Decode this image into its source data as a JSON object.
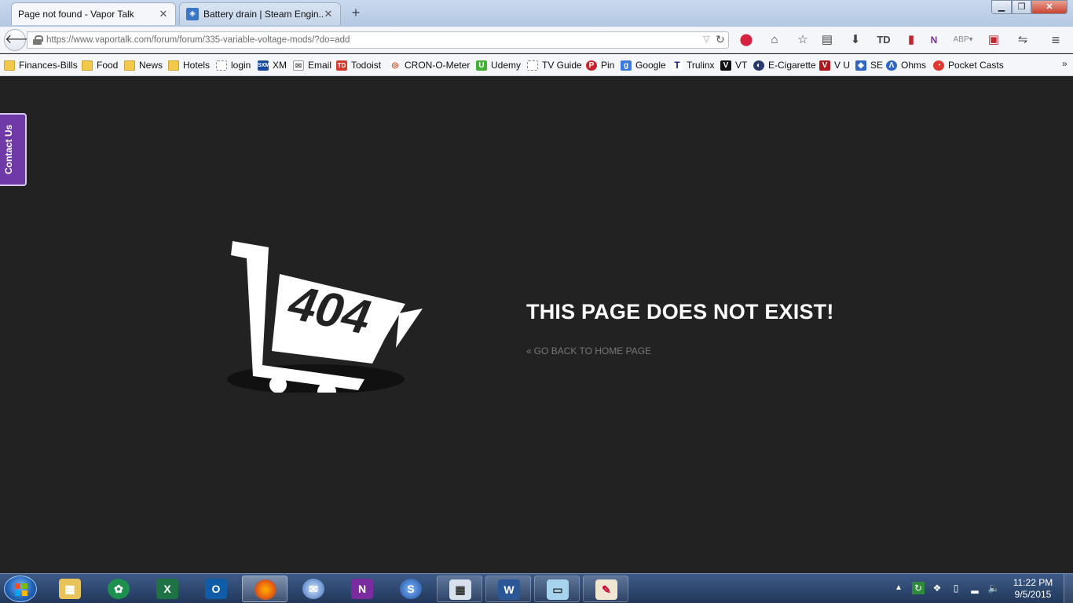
{
  "browser": {
    "tabs": [
      {
        "title": "Page not found - Vapor Talk",
        "active": true
      },
      {
        "title": "Battery drain | Steam Engin...",
        "active": false
      }
    ],
    "new_tab": "+",
    "close_glyph": "✕",
    "url": "https://www.vaportalk.com/forum/forum/335-variable-voltage-mods/?do=add",
    "window_controls": {
      "minimize": "▁",
      "maximize": "❐",
      "close": "✕"
    }
  },
  "bookmarks": [
    {
      "label": "Finances-Bills",
      "icon": "folder-icon"
    },
    {
      "label": "Food",
      "icon": "folder-icon"
    },
    {
      "label": "News",
      "icon": "folder-icon"
    },
    {
      "label": "Hotels",
      "icon": "folder-icon"
    },
    {
      "label": "login",
      "icon": "page-icon"
    },
    {
      "label": "XM",
      "icon": "xm-icon"
    },
    {
      "label": "Email",
      "icon": "mail-icon"
    },
    {
      "label": "Todoist",
      "icon": "todoist-icon"
    },
    {
      "label": "CRON-O-Meter",
      "icon": "cronometer-icon"
    },
    {
      "label": "Udemy",
      "icon": "udemy-icon"
    },
    {
      "label": "TV Guide",
      "icon": "page-icon"
    },
    {
      "label": "Pin",
      "icon": "pinterest-icon"
    },
    {
      "label": "Google",
      "icon": "google-icon"
    },
    {
      "label": "Trulinx",
      "icon": "trulinx-icon"
    },
    {
      "label": "VT",
      "icon": "vt-icon"
    },
    {
      "label": "E-Cigarette",
      "icon": "ecig-icon"
    },
    {
      "label": "V U",
      "icon": "vu-icon"
    },
    {
      "label": "SE",
      "icon": "se-icon"
    },
    {
      "label": "Ohms",
      "icon": "ohms-icon"
    },
    {
      "label": "Pocket Casts",
      "icon": "pocketcasts-icon"
    }
  ],
  "page": {
    "contact_tab": "Contact Us",
    "illustration_text": "404",
    "heading": "THIS PAGE DOES NOT EXIST!",
    "home_link": "GO BACK TO HOME PAGE",
    "home_link_chevron": "«"
  },
  "taskbar": {
    "clock_time": "11:22 PM",
    "clock_date": "9/5/2015"
  },
  "colors": {
    "page_background": "#222222",
    "contact_tab": "#6f3aa8",
    "heading": "#ffffff",
    "link": "#777777"
  }
}
